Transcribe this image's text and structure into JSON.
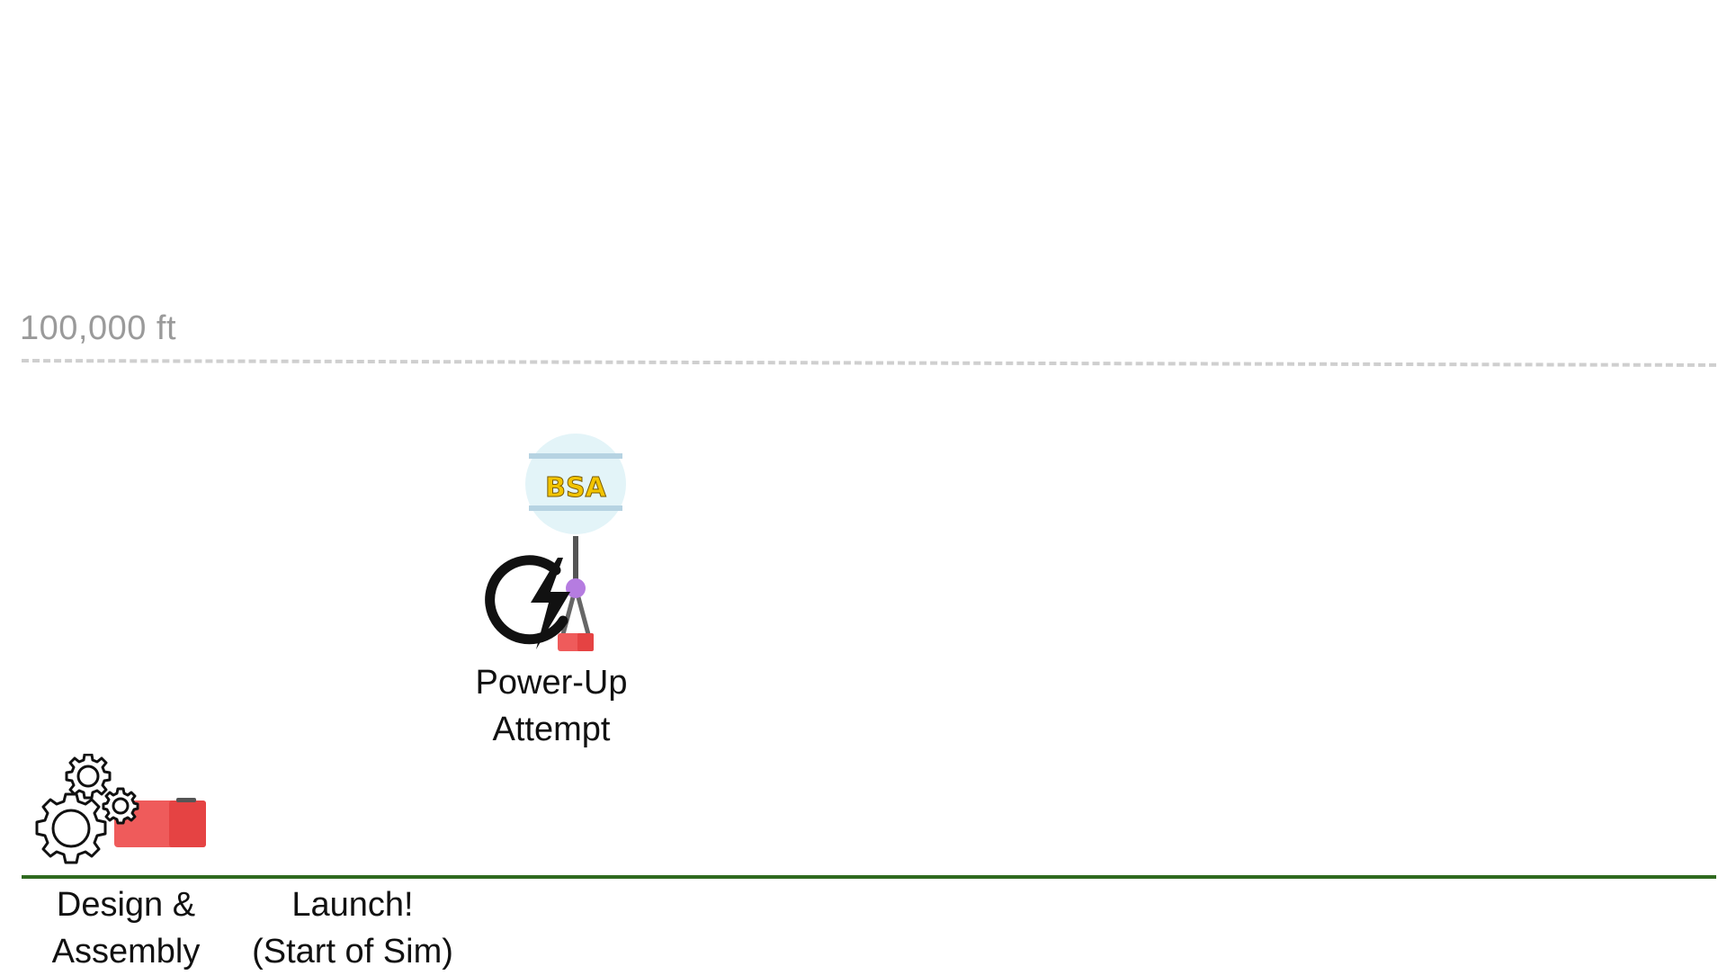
{
  "altitude_marker": {
    "label": "100,000 ft"
  },
  "stages": {
    "design": {
      "line1": "Design &",
      "line2": "Assembly"
    },
    "launch": {
      "line1": "Launch!",
      "line2": "(Start of Sim)"
    },
    "powerup": {
      "line1": "Power-Up",
      "line2": "Attempt"
    }
  },
  "balloon": {
    "logo_text": "BSA"
  },
  "icons": [
    "gears-icon",
    "payload-box-icon",
    "balloon-icon",
    "lightning-power-icon"
  ],
  "colors": {
    "ground": "#2f6a1f",
    "altitude_line": "#cfcfcf",
    "payload": "#ef5b5b",
    "balloon": "#e3f4f8",
    "logo": "#f2c400",
    "connector": "#b57ce0"
  }
}
